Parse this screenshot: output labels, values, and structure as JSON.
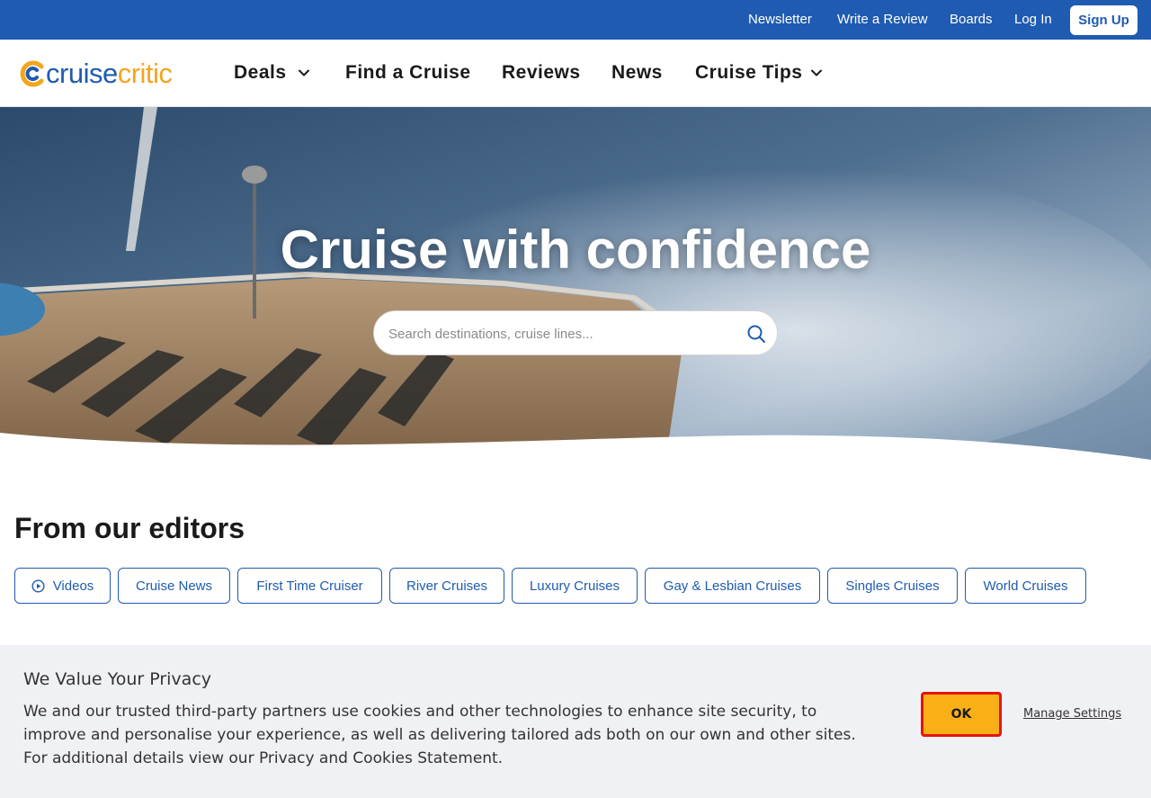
{
  "topbar": {
    "links": [
      "Newsletter",
      "Write a Review",
      "Boards",
      "Log In"
    ],
    "signup_label": "Sign Up"
  },
  "logo": {
    "part1": "cruise",
    "part2": "critic"
  },
  "nav": {
    "items": [
      {
        "label": "Deals",
        "icon": "chevron-down-icon"
      },
      {
        "label": "Find a Cruise"
      },
      {
        "label": "Reviews"
      },
      {
        "label": "News"
      },
      {
        "label": "Cruise Tips",
        "icon": "chevron-down-icon"
      }
    ]
  },
  "hero": {
    "title": "Cruise with confidence",
    "search_placeholder": "Search destinations, cruise lines...",
    "search_icon": "search-icon"
  },
  "editors": {
    "title": "From our editors",
    "chips": [
      "Videos",
      "Cruise News",
      "First Time Cruiser",
      "River Cruises",
      "Luxury Cruises",
      "Gay & Lesbian Cruises",
      "Singles Cruises",
      "World Cruises"
    ]
  },
  "privacy": {
    "title": "We Value Your Privacy",
    "body": "We and our trusted third-party partners use cookies and other technologies to enhance site security, to improve and personalise your experience, as well as delivering tailored ads both on our own and other sites. For additional details view our Privacy and Cookies Statement.",
    "ok_label": "OK",
    "manage_label": "Manage Settings"
  },
  "colors": {
    "brand_blue": "#1f5bb0",
    "brand_orange": "#f4a51c",
    "ok_button": "#f9b016",
    "ok_border": "#e8130e"
  }
}
